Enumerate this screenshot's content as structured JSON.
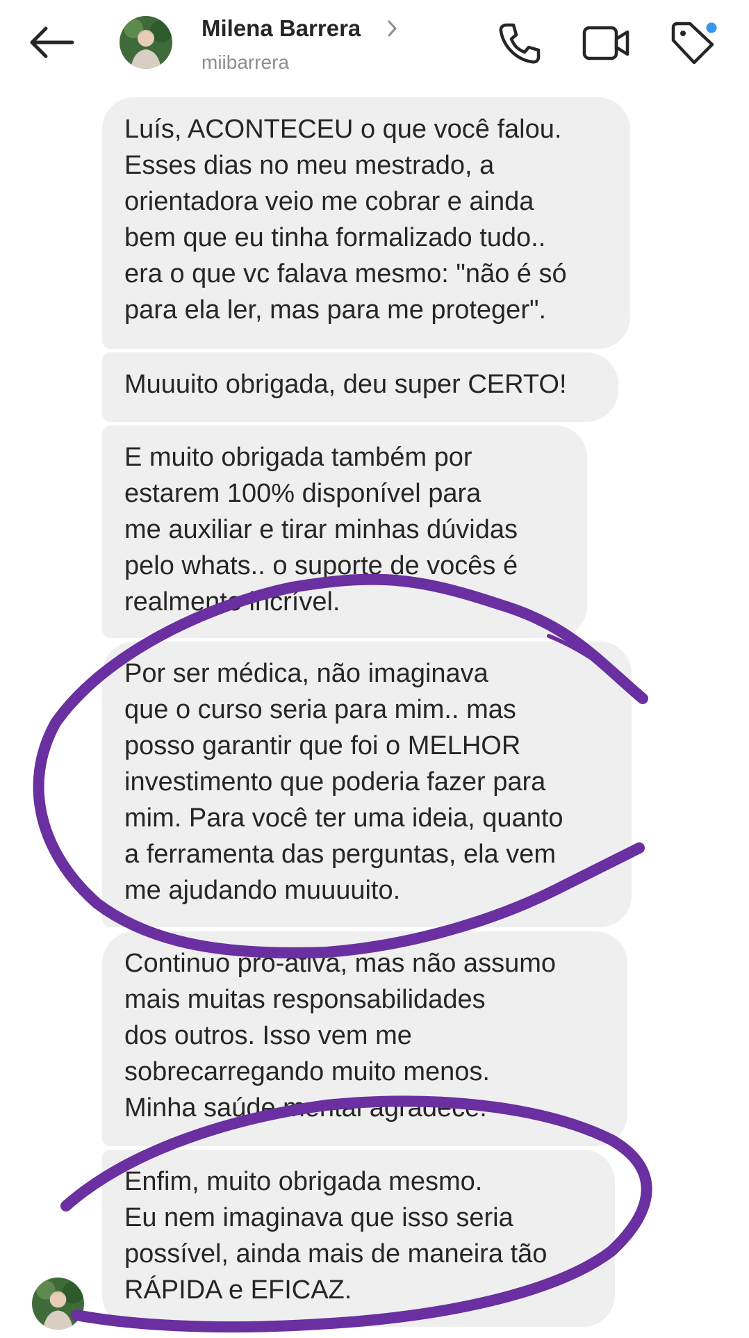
{
  "header": {
    "name": "Milena Barrera",
    "username": "miibarrera",
    "icons": {
      "back": "arrow-left-icon",
      "chevron": "chevron-right-icon",
      "call": "phone-icon",
      "video": "video-camera-icon",
      "tag": "tag-icon"
    },
    "notification_dot_color": "#3897f0"
  },
  "messages": [
    {
      "text": "Luís, ACONTECEU o que você falou.\nEsses dias no meu mestrado, a\norientadora veio me cobrar e ainda\nbem que eu tinha formalizado tudo..\nera o que vc falava mesmo: \"não é só\npara ela ler, mas para me proteger\"."
    },
    {
      "text": "Muuuito obrigada, deu super CERTO!"
    },
    {
      "text": "E muito obrigada também por\nestarem 100% disponível para\nme auxiliar e tirar minhas dúvidas\npelo whats.. o suporte de vocês é\nrealmente incrível."
    },
    {
      "text": "Por ser médica, não imaginava\nque o curso seria para mim.. mas\nposso garantir que foi o MELHOR\ninvestimento que poderia fazer para\nmim. Para você ter uma ideia, quanto\na ferramenta das perguntas, ela vem\nme ajudando muuuuito."
    },
    {
      "text": "Continuo pró-ativa, mas não assumo\nmais muitas responsabilidades\ndos outros. Isso vem me\nsobrecarregando muito menos.\nMinha saúde mental agradece."
    },
    {
      "text": "Enfim, muito obrigada mesmo.\nEu nem imaginava que isso seria\npossível, ainda mais de maneira tão\nRÁPIDA e EFICAZ."
    }
  ],
  "colors": {
    "bubble": "#efefef",
    "text": "#262626",
    "secondary_text": "#8e8e8e",
    "annotation_stroke": "#6a2fa0"
  }
}
